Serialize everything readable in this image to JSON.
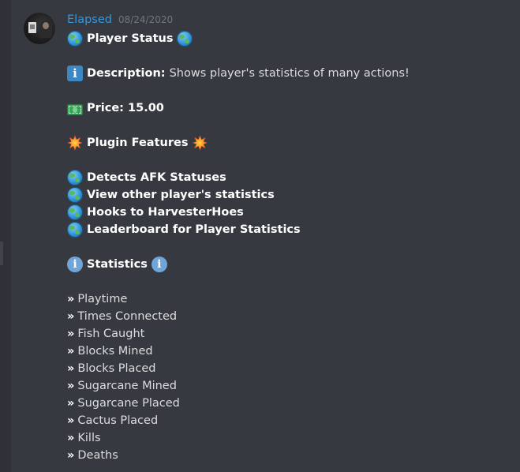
{
  "message": {
    "author": "Elapsed",
    "timestamp": "08/24/2020",
    "title": "Player Status",
    "description_label": "Description:",
    "description_text": "Shows player's statistics of many actions!",
    "price_label": "Price: 15.00",
    "features_heading": "Plugin Features",
    "features": [
      "Detects AFK Statuses",
      "View other player's statistics",
      "Hooks to HarvesterHoes",
      "Leaderboard for Player Statistics"
    ],
    "statistics_heading": "Statistics",
    "bullet_glyph": "»",
    "statistics": [
      "Playtime",
      "Times Connected",
      "Fish Caught",
      "Blocks Mined",
      "Blocks Placed",
      "Sugarcane Mined",
      "Sugarcane Placed",
      "Cactus Placed",
      "Kills",
      "Deaths"
    ]
  },
  "icons": {
    "title": "globe-icon",
    "description": "information-icon",
    "price": "dollar-banknote-icon",
    "features_heading": "collision-icon",
    "feature_items": "globe-icon",
    "statistics_heading": "information-circle-icon"
  },
  "colors": {
    "background": "#36393f",
    "username": "#3498db",
    "timestamp": "#72767d",
    "text": "#dcddde"
  }
}
